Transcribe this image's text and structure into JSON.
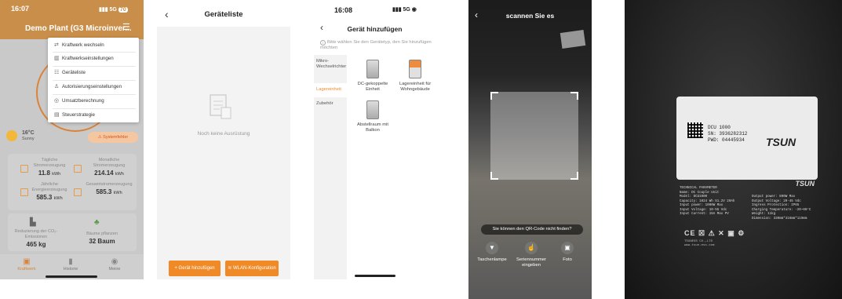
{
  "screen1": {
    "status_time": "16:07",
    "status_net": "5G",
    "status_battery": "70",
    "title": "Demo Plant (G3 Microinver...",
    "menu": [
      {
        "icon": "switch-icon",
        "label": "Kraftwerk wechseln"
      },
      {
        "icon": "plant-settings-icon",
        "label": "Kraftwerkseinstellungen"
      },
      {
        "icon": "list-icon",
        "label": "Geräteliste"
      },
      {
        "icon": "user-auth-icon",
        "label": "Autorisierungseinstellungen"
      },
      {
        "icon": "tax-icon",
        "label": "Umsatzberechnung"
      },
      {
        "icon": "strategy-icon",
        "label": "Steuerstrategie"
      }
    ],
    "weather_temp": "16°C",
    "weather_desc": "Sunny",
    "alert": "Systemfehler",
    "stats": {
      "daily_label": "Tägliche Stromerzeugung",
      "daily_value": "11.8",
      "daily_unit": "kWh",
      "monthly_label": "Monatliche Stromerzeugung",
      "monthly_value": "214.14",
      "monthly_unit": "kWh",
      "yearly_label": "Jährliche Energieerzeugung",
      "yearly_value": "585.3",
      "yearly_unit": "kWh",
      "total_label": "Gesamtstromerzeugung",
      "total_value": "585.3",
      "total_unit": "kWh"
    },
    "co2_label": "Reduzierung der CO₂-Emissionen",
    "co2_value": "465 kg",
    "trees_label": "Bäume pflanzen",
    "trees_value": "32 Baum",
    "tabs": [
      "Kraftwerk",
      "Historie",
      "Meine"
    ]
  },
  "screen2": {
    "title": "Geräteliste",
    "empty_text": "Noch keine Ausrüstung",
    "add_button": "+ Gerät hinzufügen",
    "wlan_button": "WLAN-Konfiguration"
  },
  "screen3": {
    "status_time": "16:08",
    "status_net": "5G",
    "title": "Gerät hinzufügen",
    "hint": "Bitte wählen Sie den Gerätetyp, den Sie hinzufügen möchten",
    "categories": [
      "Mikro-Wechselrichter",
      "Lagereinheit",
      "Zubehör"
    ],
    "devices": [
      {
        "label": "DC-gekoppelte Einheit"
      },
      {
        "label": "Lagereinheit für Wohngebäude"
      },
      {
        "label": "Abstellraum mit Balkon"
      }
    ]
  },
  "screen4": {
    "title": "scannen Sie es",
    "not_found": "Sie können den QR-Code nicht finden?",
    "actions": [
      "Taschenlampe",
      "Seriennummer eingeben",
      "Foto"
    ]
  },
  "screen5": {
    "sticker_model": "DCU 1000",
    "sticker_sn": "SN: 3936282312",
    "sticker_pwd": "PWD: 04445934",
    "brand": "TSUN",
    "plate_lines": [
      "TECHNICAL PARAMETER",
      "Name: DC Couple Unit",
      "Model: DCU1000",
      "Capacity: 1024 Wh 51.2V 20Ah",
      "Input power: 1000W Max",
      "Input Voltage: 10-55 Vdc",
      "Input Current: 15A Max PV"
    ],
    "plate_right": [
      "Output power: 800W Max",
      "Output Voltage: 20-45 Vdc",
      "Ingress Protection: IP65",
      "Charging Temperature: -20~60°C",
      "Weight: 11kg",
      "Dimension: 330mm*316mm*119mm"
    ],
    "cert_marks": "CE",
    "maker": "TSUNESS CO.,LTD",
    "url": "www.tsun-ess.com"
  }
}
